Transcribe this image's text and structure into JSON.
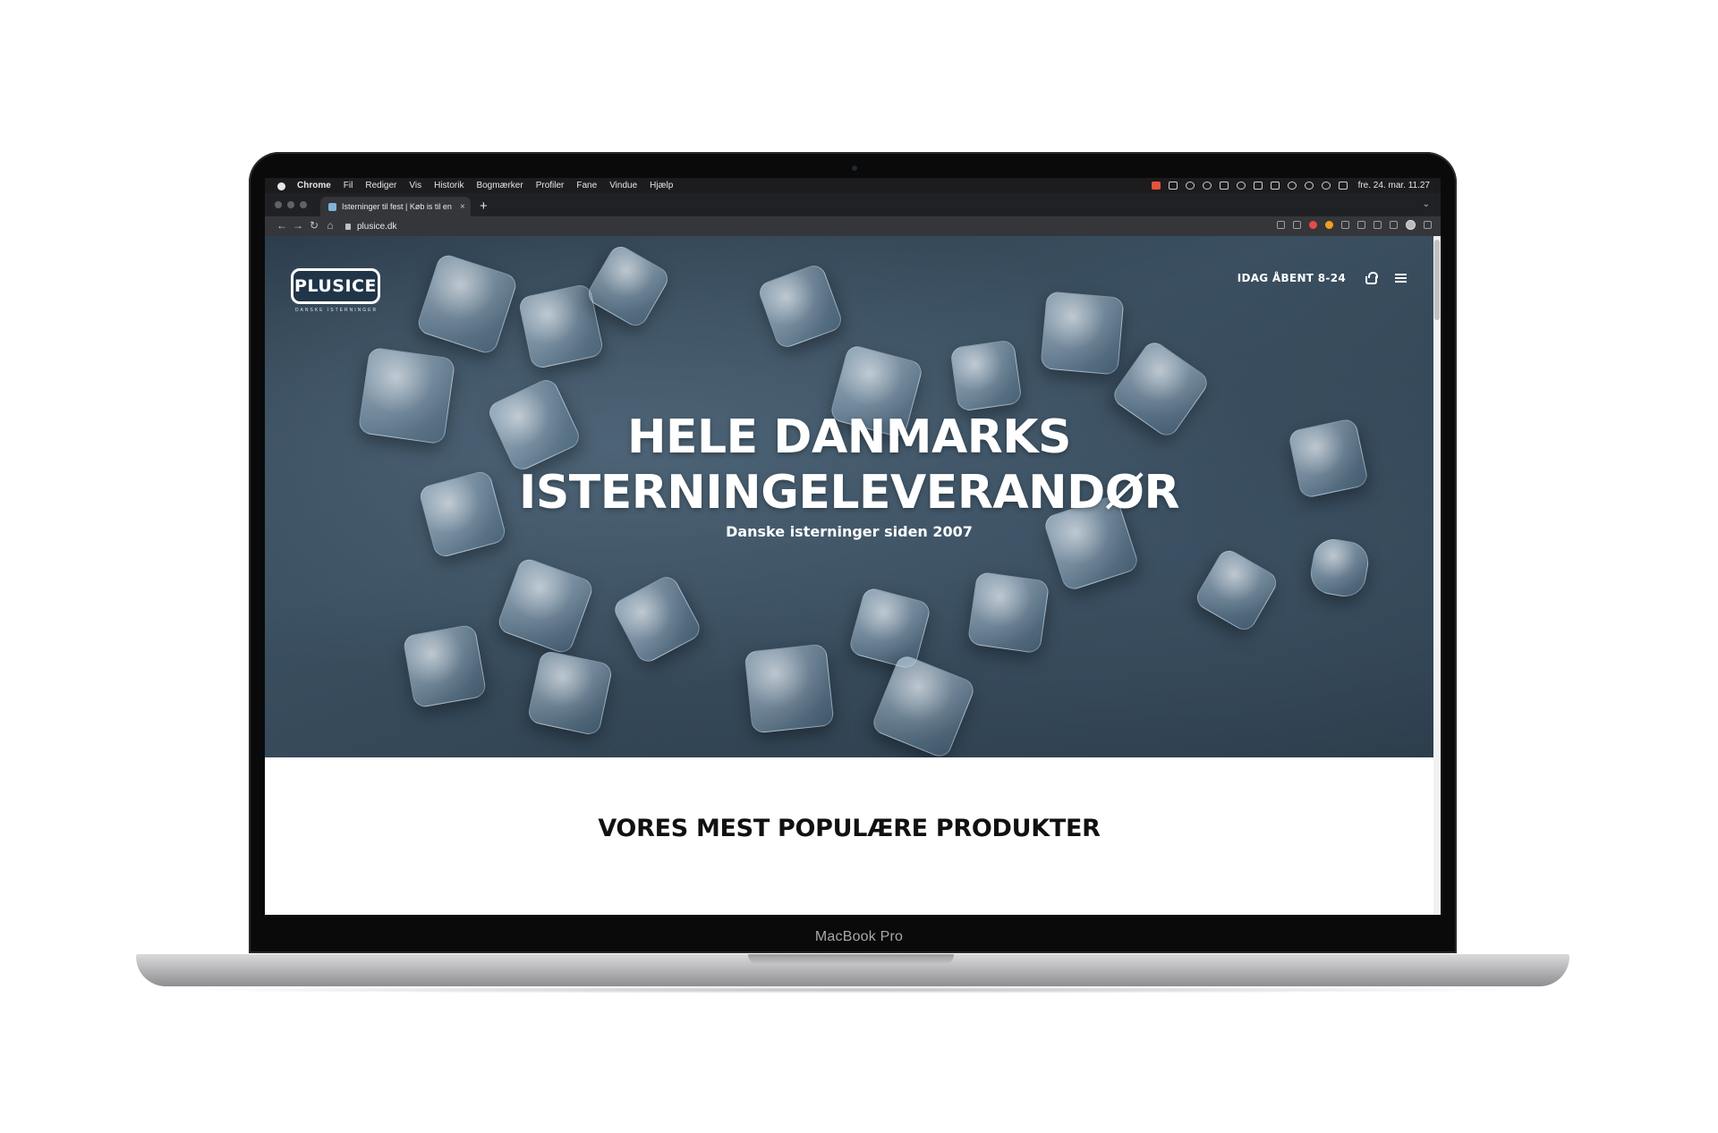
{
  "device": {
    "label": "MacBook Pro"
  },
  "menubar": {
    "items": [
      "Chrome",
      "Fil",
      "Rediger",
      "Vis",
      "Historik",
      "Bogmærker",
      "Profiler",
      "Fane",
      "Vindue",
      "Hjælp"
    ],
    "clock": "fre. 24. mar. 11.27"
  },
  "browser": {
    "tab_title": "Isterninger til fest | Køb is til en",
    "tab_close": "×",
    "new_tab": "+",
    "url": "plusice.dk"
  },
  "site": {
    "logo_text": "PLUSICE",
    "logo_tagline": "DANSKE ISTERNINGER",
    "open_hours": "IDAG ÅBENT 8-24",
    "hero_title_line1": "HELE DANMARKS",
    "hero_title_line2": "ISTERNINGELEVERANDØR",
    "hero_subtitle": "Danske isterninger siden 2007",
    "section_heading": "VORES MEST POPULÆRE PRODUKTER"
  }
}
